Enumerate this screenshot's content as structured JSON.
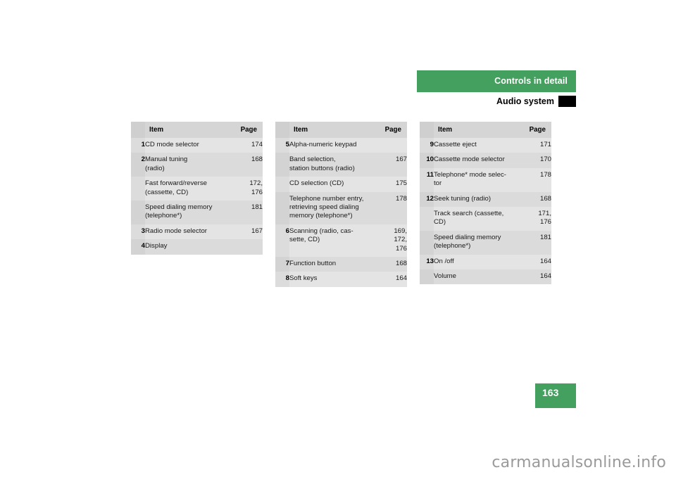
{
  "header": {
    "section_title": "Controls in detail",
    "subsection_title": "Audio system",
    "bar_color": "#43a05e",
    "tab_marker_color": "#000000"
  },
  "tables": [
    {
      "columns": {
        "num": "",
        "item": "Item",
        "page": "Page"
      },
      "rows": [
        {
          "num": "1",
          "item": "CD mode selector",
          "page": "174"
        },
        {
          "num": "2",
          "item": "Manual tuning\n(radio)",
          "page": "168"
        },
        {
          "num": "",
          "item": "Fast forward/reverse\n(cassette, CD)",
          "page": "172,\n176"
        },
        {
          "num": "",
          "item": "Speed dialing memory\n(telephone*)",
          "page": "181"
        },
        {
          "num": "3",
          "item": "Radio mode selector",
          "page": "167"
        },
        {
          "num": "4",
          "item": "Display",
          "page": ""
        }
      ]
    },
    {
      "columns": {
        "num": "",
        "item": "Item",
        "page": "Page"
      },
      "rows": [
        {
          "num": "5",
          "item": "Alpha-numeric keypad",
          "page": ""
        },
        {
          "num": "",
          "item": "Band selection,\nstation buttons (radio)",
          "page": "167"
        },
        {
          "num": "",
          "item": "CD selection (CD)",
          "page": "175"
        },
        {
          "num": "",
          "item": "Telephone number entry,\nretrieving speed dialing\nmemory (telephone*)",
          "page": "178"
        },
        {
          "num": "6",
          "item": "Scanning (radio, cas-\nsette, CD)",
          "page": "169,\n172,\n176"
        },
        {
          "num": "7",
          "item": "Function button",
          "page": "168"
        },
        {
          "num": "8",
          "item": "Soft keys",
          "page": "164"
        }
      ]
    },
    {
      "columns": {
        "num": "",
        "item": "Item",
        "page": "Page"
      },
      "rows": [
        {
          "num": "9",
          "item": "Cassette eject",
          "page": "171"
        },
        {
          "num": "10",
          "item": "Cassette mode selector",
          "page": "170"
        },
        {
          "num": "11",
          "item": "Telephone* mode selec-\ntor",
          "page": "178"
        },
        {
          "num": "12",
          "item": "Seek tuning (radio)",
          "page": "168"
        },
        {
          "num": "",
          "item": "Track search (cassette,\nCD)",
          "page": "171,\n176"
        },
        {
          "num": "",
          "item": "Speed dialing memory\n(telephone*)",
          "page": "181"
        },
        {
          "num": "13",
          "item": "On /off",
          "page": "164"
        },
        {
          "num": "",
          "item": "Volume",
          "page": "164"
        }
      ]
    }
  ],
  "footer": {
    "page_number": "163",
    "watermark": "carmanualsonline.info"
  }
}
